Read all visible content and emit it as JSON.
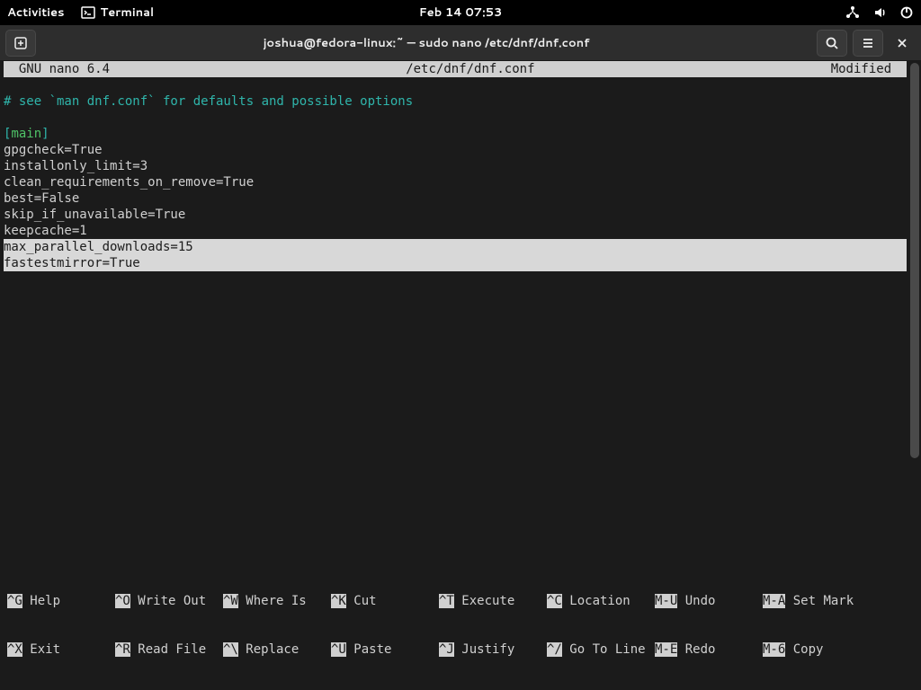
{
  "topbar": {
    "activities": "Activities",
    "app_name": "Terminal",
    "clock": "Feb 14  07:53"
  },
  "headerbar": {
    "title": "joshua@fedora-linux:~ — sudo nano /etc/dnf/dnf.conf"
  },
  "nano": {
    "version": "  GNU nano 6.4",
    "file": "/etc/dnf/dnf.conf",
    "status": "Modified  "
  },
  "editor": {
    "comment": "# see `man dnf.conf` for defaults and possible options",
    "section_open": "[",
    "section_name": "main",
    "section_close": "]",
    "lines": [
      "gpgcheck=True",
      "installonly_limit=3",
      "clean_requirements_on_remove=True",
      "best=False",
      "skip_if_unavailable=True",
      "keepcache=1"
    ],
    "selected": [
      "max_parallel_downloads=15",
      "fastestmirror=True"
    ]
  },
  "shortcuts": {
    "row1": [
      {
        "k": "^G",
        "l": " Help"
      },
      {
        "k": "^O",
        "l": " Write Out"
      },
      {
        "k": "^W",
        "l": " Where Is"
      },
      {
        "k": "^K",
        "l": " Cut"
      },
      {
        "k": "^T",
        "l": " Execute"
      },
      {
        "k": "^C",
        "l": " Location"
      },
      {
        "k": "M-U",
        "l": " Undo"
      },
      {
        "k": "M-A",
        "l": " Set Mark"
      }
    ],
    "row2": [
      {
        "k": "^X",
        "l": " Exit"
      },
      {
        "k": "^R",
        "l": " Read File"
      },
      {
        "k": "^\\",
        "l": " Replace"
      },
      {
        "k": "^U",
        "l": " Paste"
      },
      {
        "k": "^J",
        "l": " Justify"
      },
      {
        "k": "^/",
        "l": " Go To Line"
      },
      {
        "k": "M-E",
        "l": " Redo"
      },
      {
        "k": "M-6",
        "l": " Copy"
      }
    ]
  }
}
